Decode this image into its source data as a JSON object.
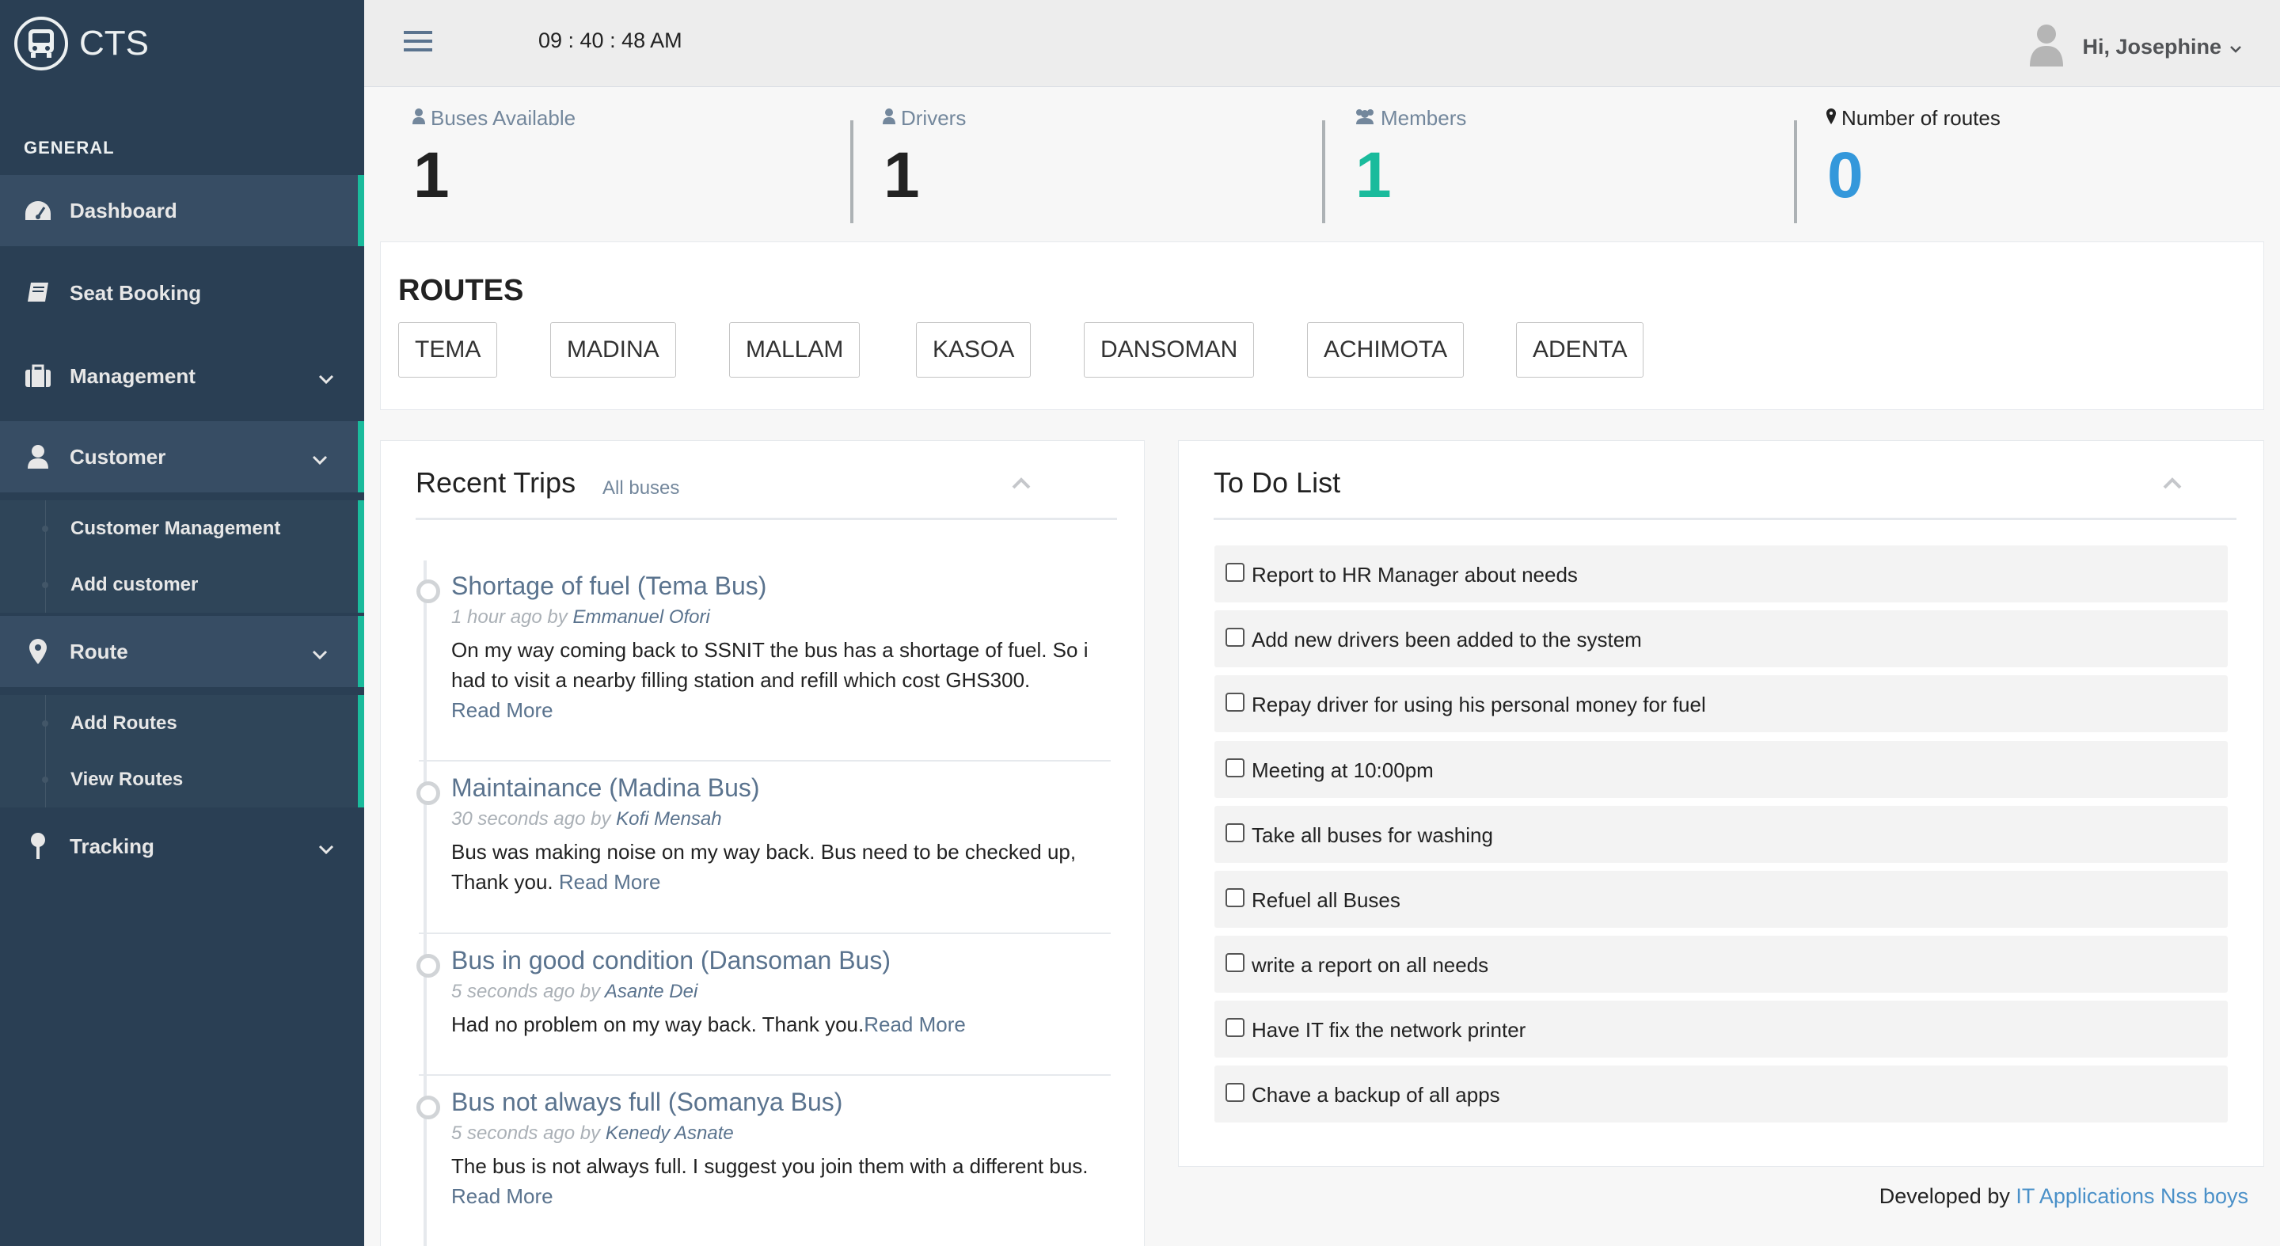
{
  "app": {
    "brand": "CTS"
  },
  "sidebar": {
    "section": "GENERAL",
    "items": [
      {
        "label": "Dashboard"
      },
      {
        "label": "Seat Booking"
      },
      {
        "label": "Management"
      },
      {
        "label": "Customer"
      },
      {
        "label": "Route"
      },
      {
        "label": "Tracking"
      }
    ],
    "customer_sub": [
      "Customer Management",
      "Add customer"
    ],
    "route_sub": [
      "Add Routes",
      "View Routes"
    ]
  },
  "header": {
    "clock": "09 : 40 : 48 AM",
    "greeting": "Hi, Josephine"
  },
  "stats": [
    {
      "label": "Buses Available",
      "value": "1",
      "color": "#222222"
    },
    {
      "label": "Drivers",
      "value": "1",
      "color": "#222222"
    },
    {
      "label": "Members",
      "value": "1",
      "color": "#1abb9c"
    },
    {
      "label": "Number of routes",
      "value": "0",
      "color": "#3498db"
    }
  ],
  "routes": {
    "title": "ROUTES",
    "buttons": [
      "TEMA",
      "MADINA",
      "MALLAM",
      "KASOA",
      "DANSOMAN",
      "ACHIMOTA",
      "ADENTA"
    ]
  },
  "recent_trips": {
    "title": "Recent Trips",
    "subtitle": "All buses",
    "items": [
      {
        "title": "Shortage of fuel (Tema Bus)",
        "time": "1 hour ago by",
        "author": "Emmanuel Ofori",
        "body": "On my way coming back to SSNIT the bus has a shortage of fuel. So i had to visit a nearby filling station and refill which cost GHS300.",
        "read_more": "Read More"
      },
      {
        "title": "Maintainance (Madina Bus)",
        "time": "30 seconds ago by",
        "author": "Kofi Mensah",
        "body": "Bus was making noise on my way back. Bus need to be checked up, Thank you.",
        "read_more": "Read More"
      },
      {
        "title": "Bus in good condition (Dansoman Bus)",
        "time": "5 seconds ago by",
        "author": "Asante Dei",
        "body": "Had no problem on my way back. Thank you.",
        "read_more": "Read More"
      },
      {
        "title": "Bus not always full (Somanya Bus)",
        "time": "5 seconds ago by",
        "author": "Kenedy Asnate",
        "body": "The bus is not always full. I suggest you join them with a different bus.",
        "read_more": "Read More"
      }
    ]
  },
  "todo": {
    "title": "To Do List",
    "items": [
      "Report to HR Manager about needs",
      "Add new drivers been added to the system",
      "Repay driver for using his personal money for fuel",
      "Meeting at 10:00pm",
      "Take all buses for washing",
      "Refuel all Buses",
      "write a report on all needs",
      "Have IT fix the network printer",
      "Chave a backup of all apps"
    ]
  },
  "footer": {
    "prefix": "Developed by",
    "link": "IT Applications Nss boys"
  },
  "colors": {
    "sidebar": "#2a3f54",
    "accent": "#1abb9c",
    "link": "#5a738e",
    "blue": "#3498db"
  }
}
